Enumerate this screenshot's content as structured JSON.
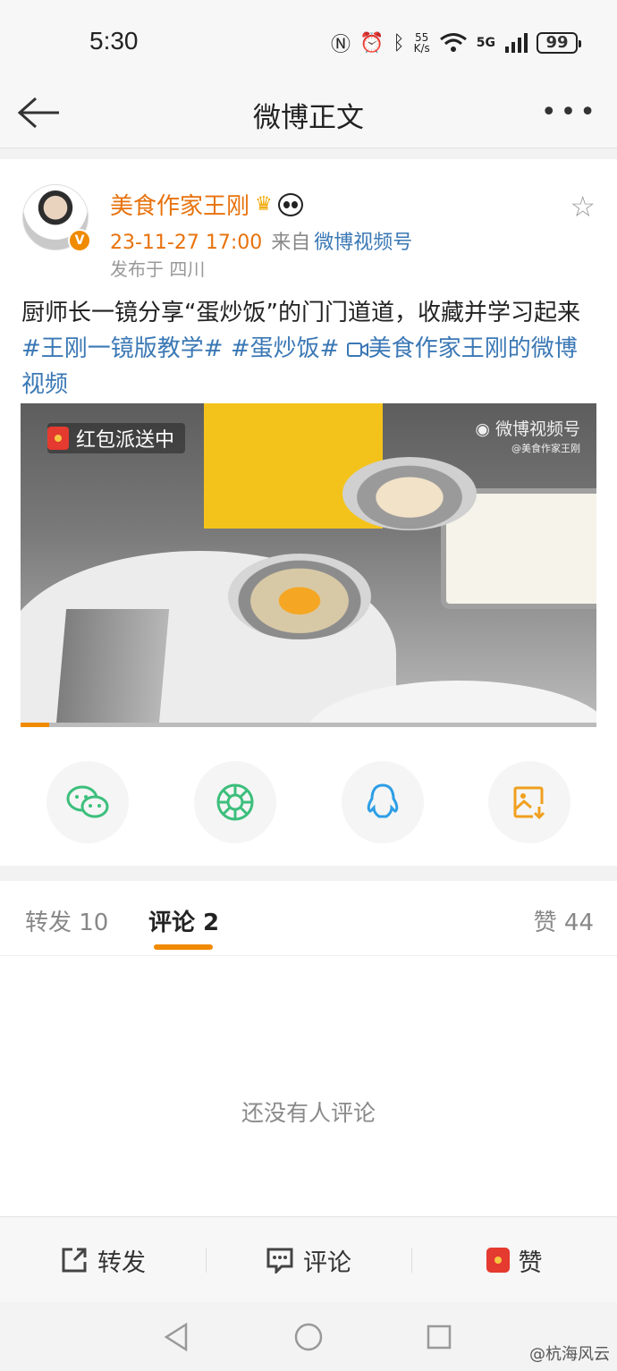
{
  "status_bar": {
    "time": "5:30",
    "speed_value": "55",
    "speed_unit": "K/s",
    "network": "5G",
    "battery": "99"
  },
  "nav": {
    "title": "微博正文"
  },
  "post": {
    "username": "美食作家王刚",
    "date": "23-11-27 17:00",
    "from_label": "来自",
    "source": "微博视频号",
    "location": "发布于 四川",
    "text": "厨师长一镜分享“蛋炒饭”的门门道道，收藏并学习起来",
    "tag1": "#王刚一镜版教学#",
    "tag2": "#蛋炒饭#",
    "video_link": "美食作家王刚的微博视频",
    "video": {
      "badge": "红包派送中",
      "watermark": "微博视频号",
      "watermark_sub": "@美食作家王刚",
      "progress": 0.05
    }
  },
  "share": {
    "icons": [
      "wechat-icon",
      "moments-icon",
      "qq-icon",
      "save-image-icon"
    ]
  },
  "tabs": {
    "repost": "转发 10",
    "comments": "评论 2",
    "likes": "赞 44"
  },
  "comments": {
    "empty_text": "还没有人评论"
  },
  "bottom_bar": {
    "repost": "转发",
    "comment": "评论",
    "like": "赞"
  },
  "footer": {
    "watermark": "@杭海风云"
  },
  "colors": {
    "accent": "#f08a00",
    "username": "#e8720c",
    "link": "#3b78b5"
  }
}
